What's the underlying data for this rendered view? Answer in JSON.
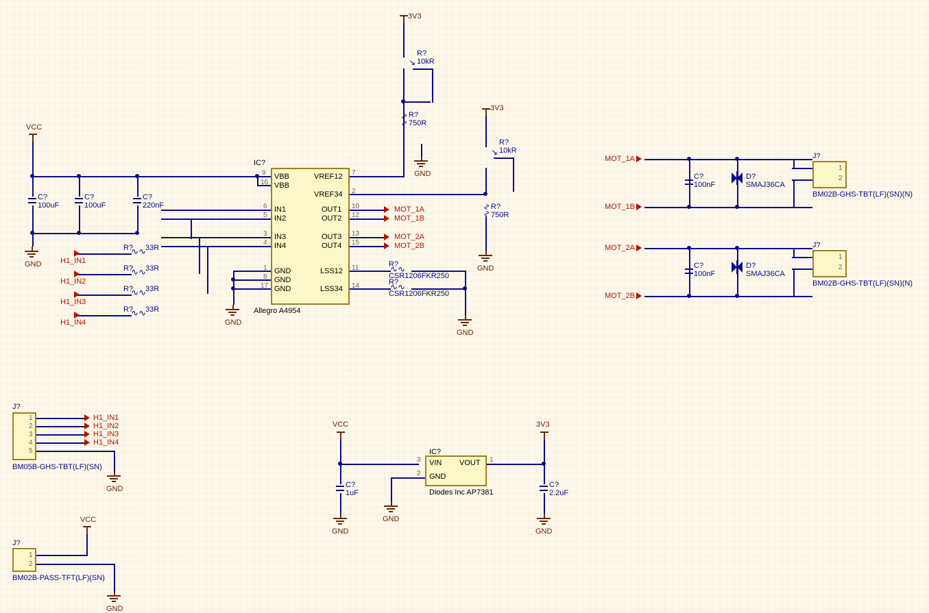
{
  "power_labels": {
    "vcc": "VCC",
    "gnd": "GND",
    "v3v3": "3V3"
  },
  "ic1": {
    "designator": "IC?",
    "part": "Allegro A4954",
    "pins": {
      "vbb1": "VBB",
      "vbb2": "VBB",
      "vref12": "VREF12",
      "vref34": "VREF34",
      "in1": "IN1",
      "in2": "IN2",
      "in3": "IN3",
      "in4": "IN4",
      "out1": "OUT1",
      "out2": "OUT2",
      "out3": "OUT3",
      "out4": "OUT4",
      "gnd1": "GND",
      "gnd2": "GND",
      "gnd3": "GND",
      "lss12": "LSS12",
      "lss34": "LSS34"
    },
    "pin_nums": {
      "vbb1": "9",
      "vbb2": "16",
      "in1": "6",
      "in2": "5",
      "in3": "3",
      "in4": "4",
      "gnd1": "1",
      "gnd2": "8",
      "gnd3": "17",
      "vref12": "7",
      "vref34": "2",
      "out1": "10",
      "out2": "12",
      "out3": "13",
      "out4": "15",
      "lss12": "11",
      "lss34": "14"
    }
  },
  "ic2": {
    "designator": "IC?",
    "part": "Diodes Inc AP7381",
    "pins": {
      "vin": "VIN",
      "gnd": "GND",
      "vout": "VOUT"
    },
    "pin_nums": {
      "vin": "3",
      "gnd": "2",
      "vout": "1"
    }
  },
  "caps": {
    "c1": {
      "d": "C?",
      "v": "100uF"
    },
    "c2": {
      "d": "C?",
      "v": "100uF"
    },
    "c3": {
      "d": "C?",
      "v": "220nF"
    },
    "c4": {
      "d": "C?",
      "v": "1uF"
    },
    "c5": {
      "d": "C?",
      "v": "2.2uF"
    },
    "c6": {
      "d": "C?",
      "v": "100nF"
    },
    "c7": {
      "d": "C?",
      "v": "100nF"
    }
  },
  "resistors": {
    "r1": {
      "d": "R?",
      "v": "33R"
    },
    "r2": {
      "d": "R?",
      "v": "33R"
    },
    "r3": {
      "d": "R?",
      "v": "33R"
    },
    "r4": {
      "d": "R?",
      "v": "33R"
    },
    "r5": {
      "d": "R?",
      "v": "10kR"
    },
    "r6": {
      "d": "R?",
      "v": "10kR"
    },
    "r7": {
      "d": "R?",
      "v": "750R"
    },
    "r8": {
      "d": "R?",
      "v": "750R"
    },
    "sense1": {
      "d": "R?",
      "v": "CSR1206FKR250"
    },
    "sense2": {
      "d": "R?",
      "v": "CSR1206FKR250"
    }
  },
  "diodes": {
    "d1": {
      "d": "D?",
      "v": "SMAJ36CA"
    },
    "d2": {
      "d": "D?",
      "v": "SMAJ36CA"
    }
  },
  "connectors": {
    "j1": {
      "d": "J?",
      "part": "BM05B-GHS-TBT(LF)(SN)",
      "pins": [
        "1",
        "2",
        "3",
        "4",
        "5"
      ]
    },
    "j2": {
      "d": "J?",
      "part": "BM02B-PASS-TFT(LF)(SN)",
      "pins": [
        "1",
        "2"
      ]
    },
    "j3": {
      "d": "J?",
      "part": "BM02B-GHS-TBT(LF)(SN)(N)",
      "pins": [
        "1",
        "2"
      ]
    },
    "j4": {
      "d": "J?",
      "part": "BM02B-GHS-TBT(LF)(SN)(N)",
      "pins": [
        "1",
        "2"
      ]
    }
  },
  "nets": {
    "h1_in1": "H1_IN1",
    "h1_in2": "H1_IN2",
    "h1_in3": "H1_IN3",
    "h1_in4": "H1_IN4",
    "mot_1a": "MOT_1A",
    "mot_1b": "MOT_1B",
    "mot_2a": "MOT_2A",
    "mot_2b": "MOT_2B"
  }
}
